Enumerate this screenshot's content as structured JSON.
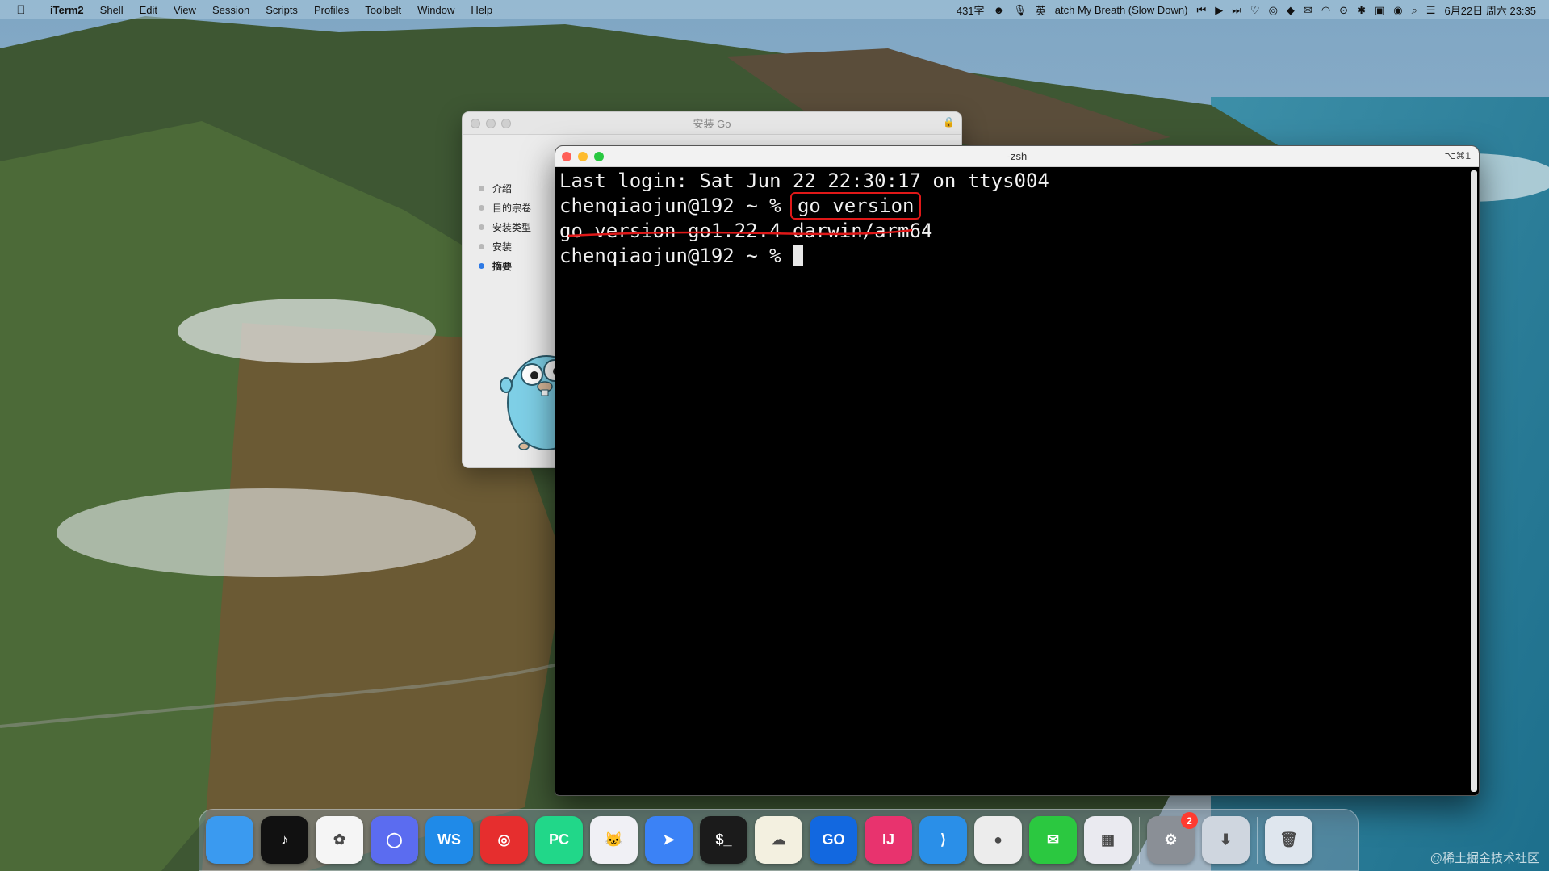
{
  "menubar": {
    "app_name": "iTerm2",
    "menus": [
      "Shell",
      "Edit",
      "View",
      "Session",
      "Scripts",
      "Profiles",
      "Toolbelt",
      "Window",
      "Help"
    ],
    "word_count": "431字",
    "input_method": "英",
    "now_playing": "atch My Breath (Slow Down)",
    "datetime": "6月22日 周六  23:35"
  },
  "installer": {
    "title": "安装 Go",
    "steps": [
      {
        "label": "介绍",
        "active": false
      },
      {
        "label": "目的宗卷",
        "active": false
      },
      {
        "label": "安装类型",
        "active": false
      },
      {
        "label": "安装",
        "active": false
      },
      {
        "label": "摘要",
        "active": true
      }
    ]
  },
  "terminal": {
    "title": "-zsh",
    "shortcut": "⌥⌘1",
    "lines": {
      "login": "Last login: Sat Jun 22 22:30:17 on ttys004",
      "prompt1": "chenqiaojun@192 ~ % ",
      "command": "go version",
      "output": "go version go1.22.4 darwin/arm64",
      "prompt2": "chenqiaojun@192 ~ % "
    }
  },
  "dock": {
    "apps": [
      {
        "name": "finder",
        "label": "",
        "color": "#3a9af0"
      },
      {
        "name": "tiktok",
        "label": "♪",
        "color": "#111111"
      },
      {
        "name": "app-3",
        "label": "✿",
        "color": "#f5f5f5"
      },
      {
        "name": "app-4",
        "label": "◯",
        "color": "#5b6cf0"
      },
      {
        "name": "webstorm",
        "label": "WS",
        "color": "#1f8ae8"
      },
      {
        "name": "netease-music",
        "label": "◎",
        "color": "#e62e2e"
      },
      {
        "name": "pycharm",
        "label": "PC",
        "color": "#21d789"
      },
      {
        "name": "app-8",
        "label": "🐱",
        "color": "#f0f0f5"
      },
      {
        "name": "app-9",
        "label": "➤",
        "color": "#3b82f6"
      },
      {
        "name": "terminal",
        "label": "$_",
        "color": "#1b1b1b"
      },
      {
        "name": "app-11",
        "label": "☁",
        "color": "#f3f0e0"
      },
      {
        "name": "goland",
        "label": "GO",
        "color": "#1268e0"
      },
      {
        "name": "intellij",
        "label": "IJ",
        "color": "#e8336e"
      },
      {
        "name": "vscode",
        "label": "⟩",
        "color": "#2a8fe8"
      },
      {
        "name": "chrome",
        "label": "●",
        "color": "#ececec"
      },
      {
        "name": "wechat",
        "label": "✉",
        "color": "#2bc840"
      },
      {
        "name": "launchpad",
        "label": "▦",
        "color": "#eaeaf0"
      }
    ],
    "system_apps": [
      {
        "name": "system-settings",
        "label": "⚙",
        "color": "#8a8f96",
        "badge": "2"
      },
      {
        "name": "downloads",
        "label": "⬇",
        "color": "#cfd6df"
      }
    ],
    "trash": {
      "name": "trash",
      "label": "🗑",
      "color": "#dfe6ee"
    }
  },
  "watermark": "@稀土掘金技术社区"
}
